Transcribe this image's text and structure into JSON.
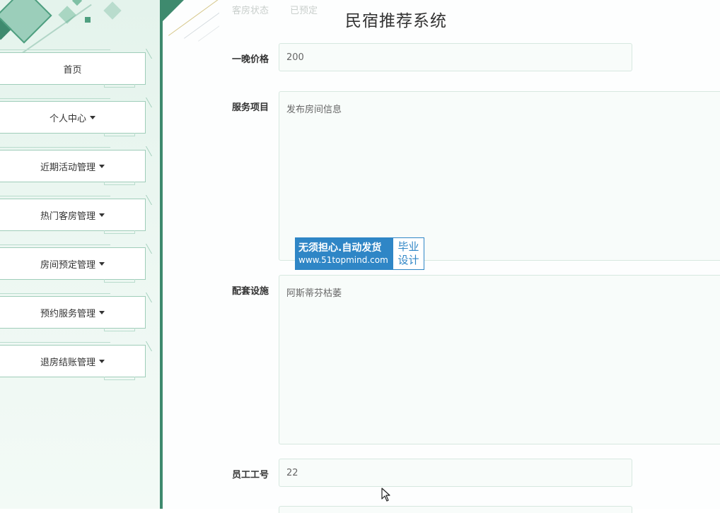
{
  "app": {
    "title": "民宿推荐系统"
  },
  "sidebar": {
    "items": [
      {
        "label": "首页",
        "has_caret": false
      },
      {
        "label": "个人中心",
        "has_caret": true
      },
      {
        "label": "近期活动管理",
        "has_caret": true
      },
      {
        "label": "热门客房管理",
        "has_caret": true
      },
      {
        "label": "房间预定管理",
        "has_caret": true
      },
      {
        "label": "预约服务管理",
        "has_caret": true
      },
      {
        "label": "退房结账管理",
        "has_caret": true
      }
    ]
  },
  "form": {
    "partial_top": {
      "label": "客房状态",
      "value": "已预定"
    },
    "price": {
      "label": "一晚价格",
      "value": "200"
    },
    "service": {
      "label": "服务项目",
      "value": "发布房间信息"
    },
    "facilities": {
      "label": "配套设施",
      "value": "阿斯蒂芬枯萎"
    },
    "staff_id": {
      "label": "员工工号",
      "value": "22"
    }
  },
  "watermark": {
    "line1": "无须担心.自动发货",
    "line2": "www.51topmind.com",
    "side": "毕业设计"
  },
  "colors": {
    "accent": "#3e8a6e",
    "sidebar_bg": "#e4f3ec",
    "watermark_blue": "#2f86c6"
  }
}
